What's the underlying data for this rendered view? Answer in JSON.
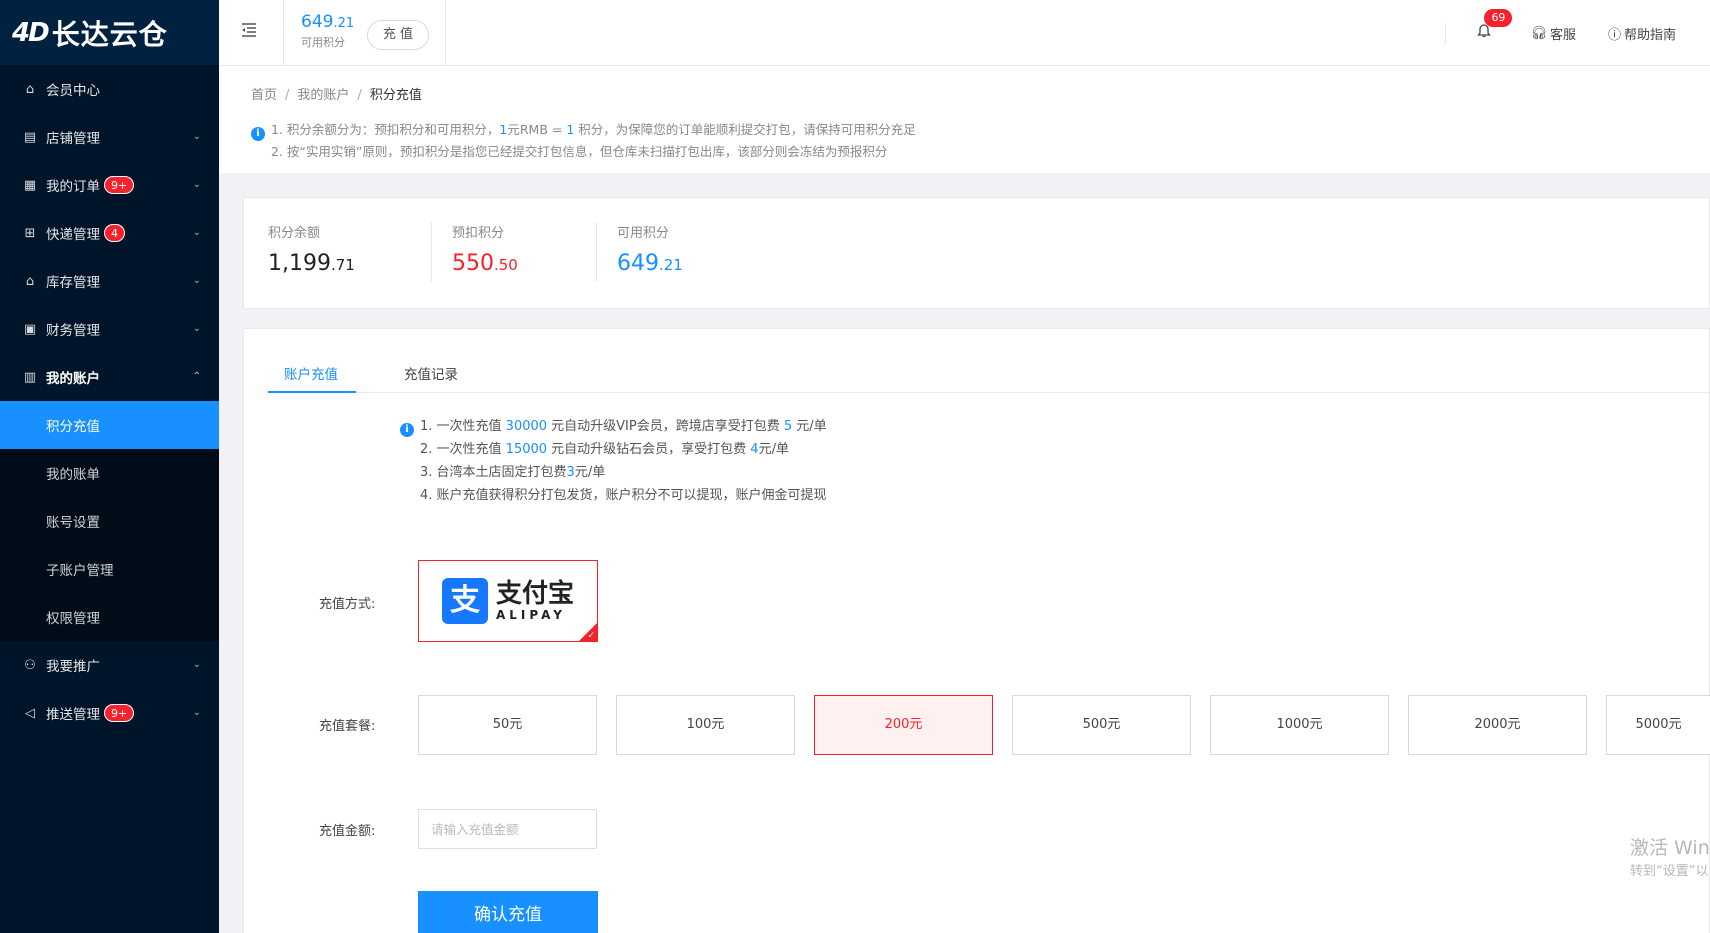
{
  "brand": {
    "logo_mark": "4D",
    "logo_text": "长达云仓"
  },
  "sidebar": {
    "items": [
      {
        "label": "会员中心",
        "icon": "home-icon",
        "glyph": "⌂",
        "badge": "",
        "chevron": ""
      },
      {
        "label": "店铺管理",
        "icon": "store-icon",
        "glyph": "▤",
        "badge": "",
        "chevron": "⌄"
      },
      {
        "label": "我的订单",
        "icon": "order-icon",
        "glyph": "▦",
        "badge": "9+",
        "chevron": "⌄"
      },
      {
        "label": "快递管理",
        "icon": "package-icon",
        "glyph": "⊞",
        "badge": "4",
        "chevron": "⌄"
      },
      {
        "label": "库存管理",
        "icon": "warehouse-icon",
        "glyph": "⌂",
        "badge": "",
        "chevron": "⌄"
      },
      {
        "label": "财务管理",
        "icon": "wallet-icon",
        "glyph": "▣",
        "badge": "",
        "chevron": "⌄"
      },
      {
        "label": "我的账户",
        "icon": "account-icon",
        "glyph": "▥",
        "badge": "",
        "chevron": "⌃"
      }
    ],
    "submenu": [
      "积分充值",
      "我的账单",
      "账号设置",
      "子账户管理",
      "权限管理"
    ],
    "active_sub": "积分充值",
    "items_after": [
      {
        "label": "我要推广",
        "icon": "promote-icon",
        "glyph": "⚇",
        "badge": "",
        "chevron": "⌄"
      },
      {
        "label": "推送管理",
        "icon": "megaphone-icon",
        "glyph": "◁",
        "badge": "9+",
        "chevron": "⌄"
      }
    ]
  },
  "header": {
    "points_int": "649",
    "points_dec": ".21",
    "points_label": "可用积分",
    "recharge_label": "充 值",
    "notification_count": "69",
    "service_label": "客服",
    "help_label": "帮助指南"
  },
  "breadcrumb": {
    "home": "首页",
    "account": "我的账户",
    "current": "积分充值",
    "sep": "/"
  },
  "notice": {
    "line1_a": "1. 积分余额分为：预扣积分和可用积分，",
    "line1_b": "1",
    "line1_c": "元RMB = ",
    "line1_d": "1",
    "line1_e": " 积分，为保障您的订单能顺利提交打包，请保持可用积分充足",
    "line2": "2. 按“实用实销”原则，预扣积分是指您已经提交打包信息，但仓库未扫描打包出库，该部分则会冻结为预报积分"
  },
  "balance": {
    "total_label": "积分余额",
    "total_int": "1,199",
    "total_dec": ".71",
    "reserved_label": "预扣积分",
    "reserved_int": "550",
    "reserved_dec": ".50",
    "available_label": "可用积分",
    "available_int": "649",
    "available_dec": ".21"
  },
  "tabs": {
    "recharge": "账户充值",
    "history": "充值记录"
  },
  "tips": {
    "t1_a": "1. 一次性充值 ",
    "t1_b": "30000",
    "t1_c": " 元自动升级VIP会员，跨境店享受打包费 ",
    "t1_d": "5",
    "t1_e": " 元/单",
    "t2_a": "2. 一次性充值 ",
    "t2_b": "15000",
    "t2_c": " 元自动升级钻石会员，享受打包费 ",
    "t2_d": "4",
    "t2_e": "元/单",
    "t3_a": "3. 台湾本土店固定打包费",
    "t3_b": "3",
    "t3_c": "元/单",
    "t4": "4. 账户充值获得积分打包发货，账户积分不可以提现，账户佣金可提现"
  },
  "form": {
    "method_label": "充值方式:",
    "alipay_cn": "支付宝",
    "alipay_en": "ALIPAY",
    "alipay_glyph": "支",
    "package_label": "充值套餐:",
    "packages": [
      "50元",
      "100元",
      "200元",
      "500元",
      "1000元",
      "2000元",
      "5000元"
    ],
    "selected_package": "200元",
    "amount_label": "充值金额:",
    "amount_placeholder": "请输入充值金额",
    "confirm_label": "确认充值"
  },
  "watermark": {
    "line1": "激活 Win",
    "line2": "转到“设置”以"
  },
  "colors": {
    "primary": "#1890ff",
    "danger": "#f5222d",
    "sidebar": "#001529"
  }
}
